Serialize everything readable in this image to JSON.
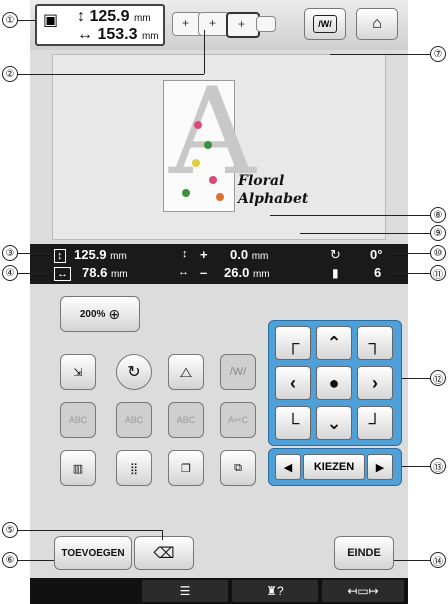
{
  "callouts": [
    "①",
    "②",
    "③",
    "④",
    "⑤",
    "⑥",
    "⑦",
    "⑧",
    "⑨",
    "⑩",
    "⑪",
    "⑫",
    "⑬",
    "⑭"
  ],
  "size_box": {
    "height": "125.9",
    "width": "153.3",
    "unit": "mm"
  },
  "pattern": {
    "text_line1": "Floral",
    "text_line2": "Alphabet"
  },
  "info": {
    "height": "125.9",
    "width": "78.6",
    "offset_v": "0.0",
    "offset_h": "26.0",
    "rotation": "0°",
    "colors": "6",
    "unit": "mm",
    "plus": "+",
    "minus": "–"
  },
  "zoom": {
    "label": "200%"
  },
  "kiezen": {
    "label": "KIEZEN"
  },
  "buttons": {
    "add": "TOEVOEGEN",
    "end": "EINDE"
  },
  "colors": {
    "accent_blue": "#4f9fd8",
    "infobar": "#1a1a1a"
  }
}
